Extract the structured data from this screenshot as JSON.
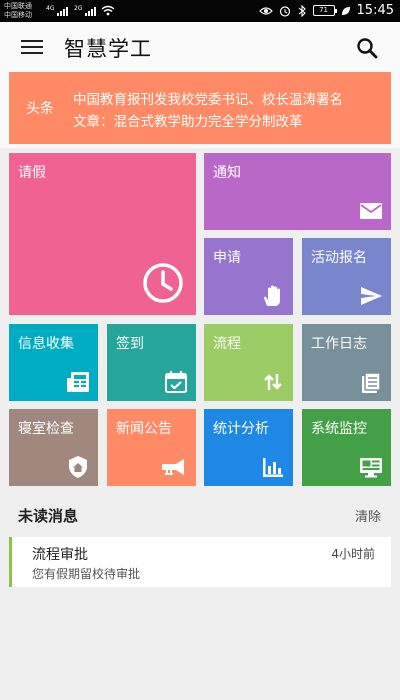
{
  "status_bar": {
    "carrier_1": "中国联通",
    "carrier_2": "中国移动",
    "net_1": "4G",
    "net_2": "2G",
    "battery": "71",
    "time": "15:45"
  },
  "app_bar": {
    "title": "智慧学工",
    "menu_icon": "menu-icon",
    "search_icon": "search-icon"
  },
  "news": {
    "label": "头条",
    "text_line_1": "中国教育报刊发我校党委书记、校长温涛署名",
    "text_line_2": "文章：混合式教学助力完全学分制改革",
    "background": "#ff8a65"
  },
  "tiles": [
    {
      "label": "请假",
      "icon": "clock-icon",
      "color": "#f06292"
    },
    {
      "label": "通知",
      "icon": "mail-icon",
      "color": "#ba68c8"
    },
    {
      "label": "申请",
      "icon": "hand-icon",
      "color": "#9575cd"
    },
    {
      "label": "活动报名",
      "icon": "send-icon",
      "color": "#7986cb"
    },
    {
      "label": "信息收集",
      "icon": "news-icon",
      "color": "#00acc1"
    },
    {
      "label": "签到",
      "icon": "calendar-check-icon",
      "color": "#26a69a"
    },
    {
      "label": "流程",
      "icon": "swap-icon",
      "color": "#9ccc65"
    },
    {
      "label": "工作日志",
      "icon": "notebook-icon",
      "color": "#78909c"
    },
    {
      "label": "寝室检查",
      "icon": "shield-home-icon",
      "color": "#a1887f"
    },
    {
      "label": "新闻公告",
      "icon": "trumpet-icon",
      "color": "#ff8a65"
    },
    {
      "label": "统计分析",
      "icon": "bar-chart-icon",
      "color": "#1e88e5"
    },
    {
      "label": "系统监控",
      "icon": "monitor-icon",
      "color": "#43a047"
    }
  ],
  "unread": {
    "title": "未读消息",
    "clear_label": "清除",
    "messages": [
      {
        "title": "流程审批",
        "time": "4小时前",
        "body": "您有假期留校待审批",
        "accent": "#8bc34a"
      }
    ]
  }
}
